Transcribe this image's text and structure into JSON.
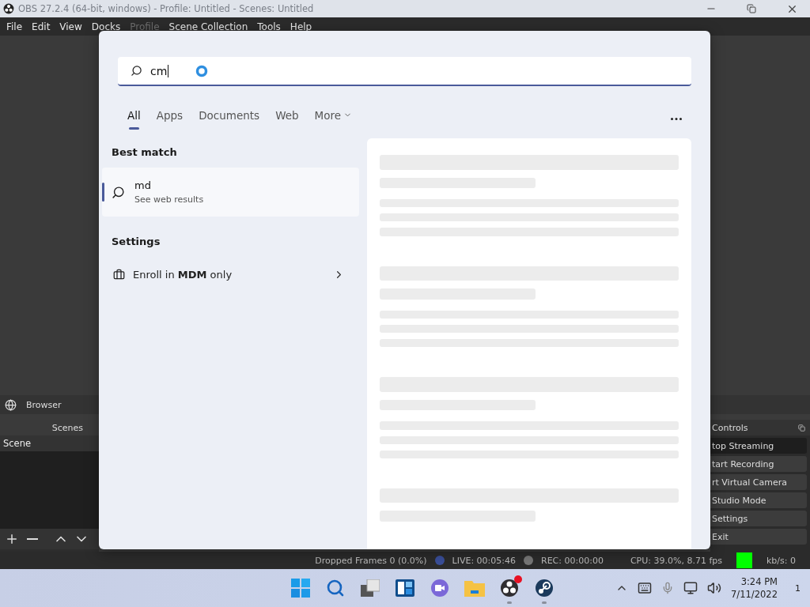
{
  "window": {
    "title": "OBS 27.2.4 (64-bit, windows) - Profile: Untitled - Scenes: Untitled"
  },
  "menu": [
    {
      "label": "File",
      "disabled": false
    },
    {
      "label": "Edit",
      "disabled": false
    },
    {
      "label": "View",
      "disabled": false
    },
    {
      "label": "Docks",
      "disabled": false
    },
    {
      "label": "Profile",
      "disabled": true
    },
    {
      "label": "Scene Collection",
      "disabled": false
    },
    {
      "label": "Tools",
      "disabled": false
    },
    {
      "label": "Help",
      "disabled": false
    }
  ],
  "browser_dock": {
    "title": "Browser"
  },
  "scenes": {
    "title": "Scenes",
    "items": [
      {
        "label": "Scene",
        "selected": true
      }
    ]
  },
  "controls": {
    "title": "Controls",
    "buttons": [
      {
        "label": "top Streaming",
        "checked": true
      },
      {
        "label": "tart Recording",
        "checked": false
      },
      {
        "label": "rt Virtual Camera",
        "checked": false
      },
      {
        "label": "Studio Mode",
        "checked": false
      },
      {
        "label": "Settings",
        "checked": false
      },
      {
        "label": "Exit",
        "checked": false
      }
    ]
  },
  "status_bar": {
    "dropped": "Dropped Frames 0 (0.0%)",
    "live": "LIVE: 00:05:46",
    "rec": "REC: 00:00:00",
    "cpu": "CPU: 39.0%, 8.71 fps",
    "bitrate": "kb/s: 0"
  },
  "search": {
    "value": "cm",
    "tabs": [
      {
        "label": "All",
        "selected": true,
        "kind": "plain"
      },
      {
        "label": "Apps",
        "selected": false,
        "kind": "plain"
      },
      {
        "label": "Documents",
        "selected": false,
        "kind": "plain"
      },
      {
        "label": "Web",
        "selected": false,
        "kind": "plain"
      },
      {
        "label": "More",
        "selected": false,
        "kind": "dropdown"
      }
    ],
    "best_match_heading": "Best match",
    "best_match": {
      "title": "md",
      "subtitle": "See web results",
      "selected": true
    },
    "settings_heading": "Settings",
    "settings_items": [
      {
        "label": "Enroll in **MDM** only"
      }
    ]
  },
  "taskbar": {
    "apps": [
      {
        "kind": "start",
        "running": false,
        "alert": false
      },
      {
        "kind": "search",
        "running": false,
        "alert": false
      },
      {
        "kind": "taskview",
        "running": false,
        "alert": false
      },
      {
        "kind": "widgets",
        "running": false,
        "alert": false
      },
      {
        "kind": "chat",
        "running": false,
        "alert": false
      },
      {
        "kind": "explorer",
        "running": false,
        "alert": false
      },
      {
        "kind": "obs",
        "running": true,
        "alert": true
      },
      {
        "kind": "steam",
        "running": true,
        "alert": false
      }
    ],
    "time": "3:24 PM",
    "date": "7/11/2022",
    "notifications": "1"
  }
}
